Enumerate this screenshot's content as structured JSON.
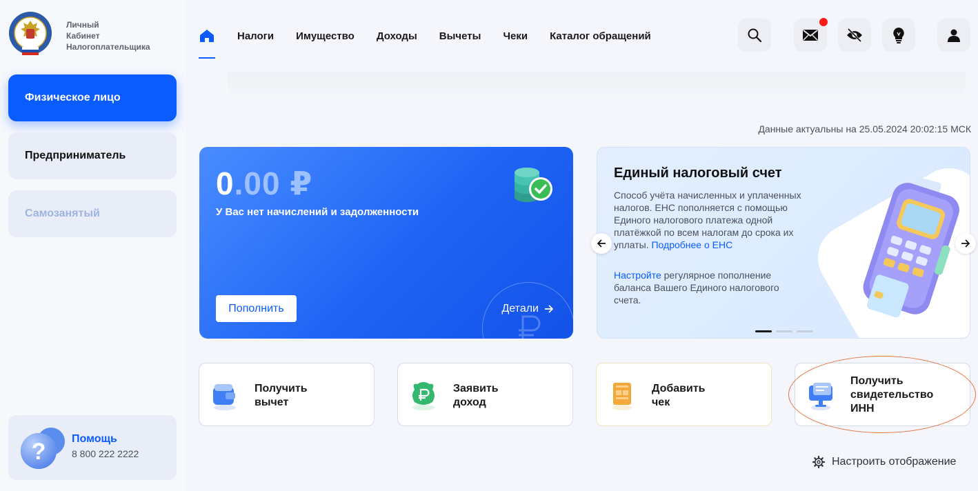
{
  "brand": {
    "line1": "Личный",
    "line2": "Кабинет",
    "line3": "Налогоплательщика"
  },
  "roles": [
    {
      "label": "Физическое лицо",
      "state": "active"
    },
    {
      "label": "Предприниматель",
      "state": "normal"
    },
    {
      "label": "Самозанятый",
      "state": "disabled"
    }
  ],
  "help": {
    "title": "Помощь",
    "phone": "8 800 222 2222"
  },
  "nav": {
    "home_icon": "home-icon",
    "items": [
      "Налоги",
      "Имущество",
      "Доходы",
      "Вычеты",
      "Чеки",
      "Каталог обращений"
    ]
  },
  "header_icons": [
    "search-icon",
    "mail-icon",
    "eye-off-icon",
    "lightbulb-icon",
    "user-icon"
  ],
  "timestamp": "Данные актуальны на 25.05.2024 20:02:15 МСК",
  "balance": {
    "amount_int": "0",
    "amount_frac": ".00",
    "currency": "₽",
    "note": "У Вас нет начислений и задолженности",
    "topup_label": "Пополнить",
    "details_label": "Детали"
  },
  "ens": {
    "title": "Единый налоговый счет",
    "text": "Способ учёта начисленных и уплаченных налогов. ЕНС пополняется с помощью Единого налогового платежа одной платёжкой по всем налогам до срока их уплаты. ",
    "more_link": "Подробнее о ЕНС",
    "setup_link": "Настройте",
    "setup_text": " регулярное пополнение баланса Вашего Единого налогового счета.",
    "slide_count": 3,
    "active_slide": 1
  },
  "actions": [
    {
      "line1": "Получить",
      "line2": "вычет",
      "line3": ""
    },
    {
      "line1": "Заявить",
      "line2": "доход",
      "line3": ""
    },
    {
      "line1": "Добавить",
      "line2": "чек",
      "line3": ""
    },
    {
      "line1": "Получить",
      "line2": "свидетельство",
      "line3": "ИНН"
    }
  ],
  "settings_label": "Настроить отображение",
  "colors": {
    "accent": "#0a5cff",
    "annotation": "#e8743b",
    "notification": "#ff1a1a"
  }
}
